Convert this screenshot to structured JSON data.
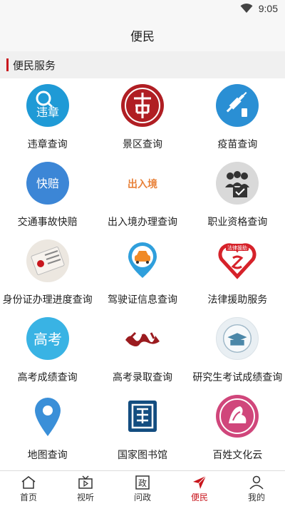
{
  "status": {
    "time": "9:05"
  },
  "header": {
    "title": "便民"
  },
  "section": {
    "title": "便民服务"
  },
  "services": [
    {
      "label": "违章查询",
      "icon": "violation-icon",
      "icon_text": "违章"
    },
    {
      "label": "景区查询",
      "icon": "scenic-area-icon"
    },
    {
      "label": "疫苗查询",
      "icon": "vaccine-icon"
    },
    {
      "label": "交通事故快赔",
      "icon": "accident-claim-icon",
      "icon_text": "快赔"
    },
    {
      "label": "出入境办理查询",
      "icon": "immigration-icon",
      "icon_text": "出入境"
    },
    {
      "label": "职业资格查询",
      "icon": "qualification-icon"
    },
    {
      "label": "身份证办理进度查询",
      "icon": "id-card-icon"
    },
    {
      "label": "驾驶证信息查询",
      "icon": "driver-license-icon"
    },
    {
      "label": "法律援助服务",
      "icon": "legal-aid-icon",
      "icon_text": "法律援助"
    },
    {
      "label": "高考成绩查询",
      "icon": "exam-score-icon",
      "icon_text": "高考"
    },
    {
      "label": "高考录取查询",
      "icon": "admission-icon"
    },
    {
      "label": "研究生考试成绩查询",
      "icon": "graduate-exam-icon"
    },
    {
      "label": "地图查询",
      "icon": "map-pin-icon"
    },
    {
      "label": "国家图书馆",
      "icon": "national-library-icon"
    },
    {
      "label": "百姓文化云",
      "icon": "culture-cloud-icon"
    }
  ],
  "tabs": [
    {
      "label": "首页",
      "icon": "home-icon"
    },
    {
      "label": "视听",
      "icon": "tv-icon"
    },
    {
      "label": "问政",
      "icon": "politics-icon",
      "icon_text": "政"
    },
    {
      "label": "便民",
      "icon": "convenience-icon",
      "active": true
    },
    {
      "label": "我的",
      "icon": "profile-icon"
    }
  ],
  "colors": {
    "accent": "#c8161d",
    "tab_active": "#c8161d"
  }
}
